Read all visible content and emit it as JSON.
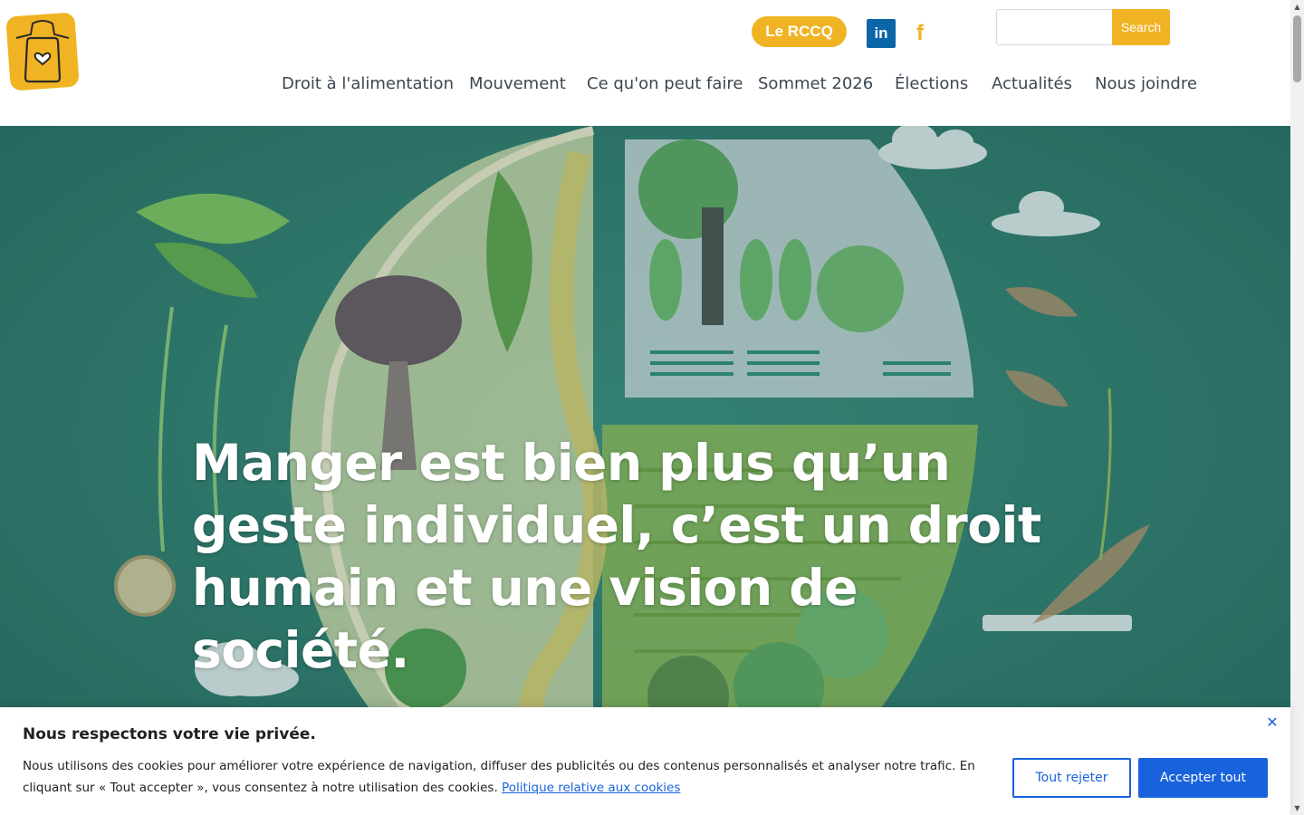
{
  "header": {
    "logo_icon": "apron-heart-icon",
    "rccq_label": "Le RCCQ",
    "social": [
      {
        "name": "linkedin-icon",
        "glyph": "in",
        "color": "#0b66a8"
      },
      {
        "name": "facebook-icon",
        "glyph": "f",
        "color": "#f0b323"
      }
    ],
    "search": {
      "placeholder": "",
      "value": "",
      "button_label": "Search"
    },
    "nav": [
      {
        "label": "Droit à l'alimentation"
      },
      {
        "label": "Mouvement"
      },
      {
        "label": "Ce qu'on peut faire"
      },
      {
        "label": "Sommet 2026"
      },
      {
        "label": "Élections"
      },
      {
        "label": "Actualités"
      },
      {
        "label": "Nous joindre"
      }
    ]
  },
  "hero": {
    "title": "Manger est bien plus qu’un geste individuel, c’est un droit humain et une vision de société."
  },
  "cookie_banner": {
    "title": "Nous respectons votre vie privée.",
    "text": "Nous utilisons des cookies pour améliorer votre expérience de navigation, diffuser des publicités ou des contenus personnalisés et analyser notre trafic. En cliquant sur « Tout accepter », vous consentez à notre utilisation des cookies.",
    "policy_link": "Politique relative aux cookies",
    "close_glyph": "✕",
    "reject_label": "Tout rejeter",
    "accept_label": "Accepter tout"
  },
  "colors": {
    "brand_yellow": "#f0b323",
    "hero_teal": "#2f7a6f",
    "cookie_blue": "#1863dc",
    "nav_text": "#3c4752"
  }
}
